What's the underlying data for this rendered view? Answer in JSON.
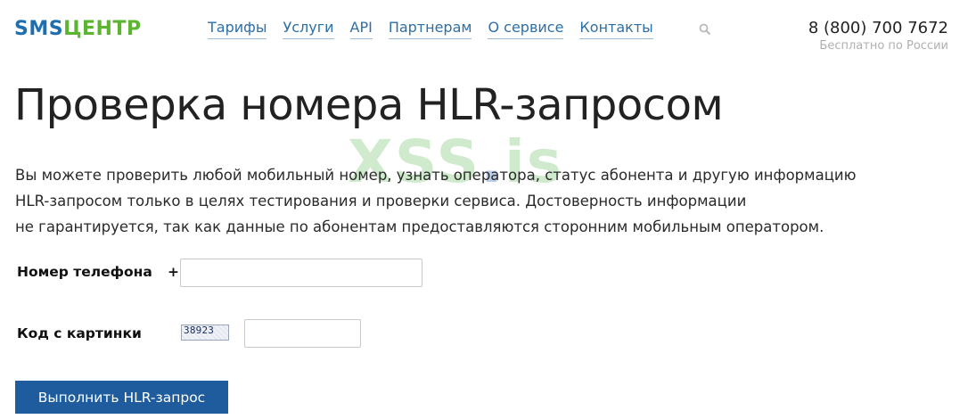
{
  "header": {
    "logo": {
      "part1": "SMS",
      "part2": "ЦЕНТР"
    },
    "nav": [
      {
        "label": "Тарифы"
      },
      {
        "label": "Услуги"
      },
      {
        "label": "API"
      },
      {
        "label": "Партнерам"
      },
      {
        "label": "О сервисе"
      },
      {
        "label": "Контакты"
      }
    ],
    "search_icon": "search-icon",
    "phone": {
      "number": "8 (800) 700 7672",
      "note": "Бесплатно по России"
    }
  },
  "main": {
    "title": "Проверка номера HLR-запросом",
    "watermark": {
      "part1": "XSS",
      "dot": ".",
      "part2": "is"
    },
    "description_lines": [
      "Вы можете проверить любой мобильный номер, узнать оператора, статус абонента и другую информацию",
      "HLR-запросом только в целях тестирования и проверки сервиса. Достоверность информации",
      "не гарантируется, так как данные по абонентам предоставляются сторонним мобильным оператором."
    ],
    "form": {
      "phone_label": "Номер телефона",
      "phone_prefix": "+",
      "phone_value": "",
      "captcha_label": "Код с картинки",
      "captcha_image_text": "38923",
      "captcha_value": "",
      "submit_label": "Выполнить HLR-запрос"
    }
  },
  "colors": {
    "logo_blue": "#1f6fae",
    "logo_green": "#5cb531",
    "link": "#2d6fa7",
    "button": "#1f5c9e"
  }
}
